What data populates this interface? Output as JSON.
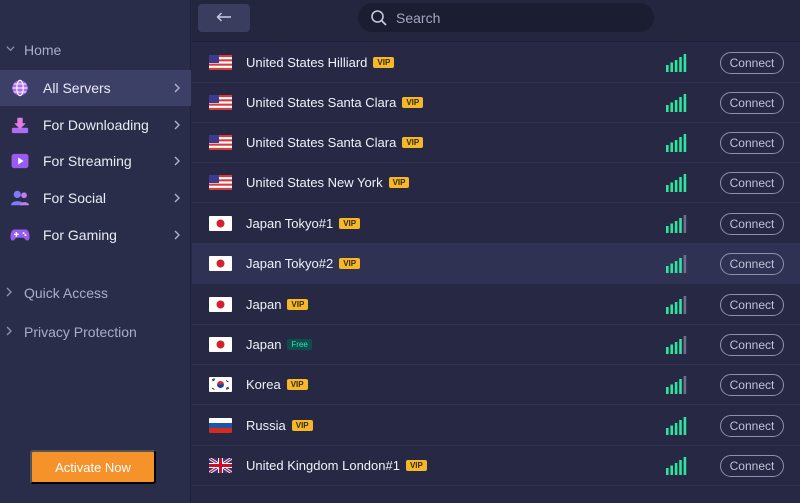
{
  "sidebar": {
    "home_label": "Home",
    "items": [
      {
        "label": "All Servers",
        "icon": "globe-icon"
      },
      {
        "label": "For Downloading",
        "icon": "download-icon"
      },
      {
        "label": "For Streaming",
        "icon": "play-icon"
      },
      {
        "label": "For Social",
        "icon": "people-icon"
      },
      {
        "label": "For Gaming",
        "icon": "gamepad-icon"
      }
    ],
    "quick_access_label": "Quick Access",
    "privacy_label": "Privacy Protection",
    "activate_label": "Activate Now"
  },
  "topbar": {
    "back_icon": "back-arrow-icon",
    "search_placeholder": "Search"
  },
  "servers": [
    {
      "name": "United States Hilliard",
      "badge": "VIP",
      "flag": "us",
      "signal_bars": 5,
      "connect": "Connect"
    },
    {
      "name": "United States Santa Clara",
      "badge": "VIP",
      "flag": "us",
      "signal_bars": 5,
      "connect": "Connect"
    },
    {
      "name": "United States Santa Clara",
      "badge": "VIP",
      "flag": "us",
      "signal_bars": 5,
      "connect": "Connect"
    },
    {
      "name": "United States New York",
      "badge": "VIP",
      "flag": "us",
      "signal_bars": 5,
      "connect": "Connect"
    },
    {
      "name": "Japan Tokyo#1",
      "badge": "VIP",
      "flag": "jp",
      "signal_bars": 4,
      "connect": "Connect"
    },
    {
      "name": "Japan Tokyo#2",
      "badge": "VIP",
      "flag": "jp",
      "signal_bars": 4,
      "connect": "Connect"
    },
    {
      "name": "Japan",
      "badge": "VIP",
      "flag": "jp",
      "signal_bars": 4,
      "connect": "Connect"
    },
    {
      "name": "Japan",
      "badge": "Free",
      "flag": "jp",
      "signal_bars": 4,
      "connect": "Connect"
    },
    {
      "name": "Korea",
      "badge": "VIP",
      "flag": "kr",
      "signal_bars": 4,
      "connect": "Connect"
    },
    {
      "name": "Russia",
      "badge": "VIP",
      "flag": "ru",
      "signal_bars": 5,
      "connect": "Connect"
    },
    {
      "name": "United Kingdom London#1",
      "badge": "VIP",
      "flag": "gb",
      "signal_bars": 5,
      "connect": "Connect"
    }
  ],
  "colors": {
    "accent_orange": "#f6922a",
    "vip_gold": "#f5b82a",
    "signal_green": "#2ee59d",
    "background": "#262844"
  }
}
